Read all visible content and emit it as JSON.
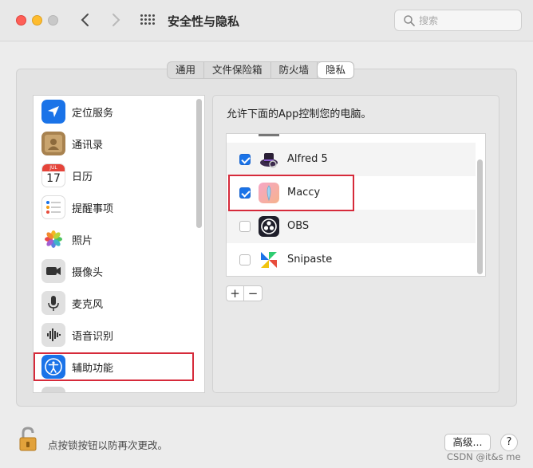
{
  "window": {
    "title": "安全性与隐私"
  },
  "search": {
    "placeholder": "搜索"
  },
  "tabs": [
    {
      "label": "通用",
      "active": false
    },
    {
      "label": "文件保险箱",
      "active": false
    },
    {
      "label": "防火墙",
      "active": false
    },
    {
      "label": "隐私",
      "active": true
    }
  ],
  "sidebar": {
    "items": [
      {
        "label": "定位服务",
        "icon": "location-arrow-icon"
      },
      {
        "label": "通讯录",
        "icon": "contacts-icon"
      },
      {
        "label": "日历",
        "icon": "calendar-icon",
        "icon_month": "JUL",
        "icon_day": "17"
      },
      {
        "label": "提醒事项",
        "icon": "reminders-icon"
      },
      {
        "label": "照片",
        "icon": "photos-icon"
      },
      {
        "label": "摄像头",
        "icon": "camera-icon"
      },
      {
        "label": "麦克风",
        "icon": "microphone-icon"
      },
      {
        "label": "语音识别",
        "icon": "speech-recognition-icon"
      },
      {
        "label": "辅助功能",
        "icon": "accessibility-icon",
        "selected": true
      }
    ]
  },
  "main": {
    "description": "允许下面的App控制您的电脑。",
    "apps": [
      {
        "name": "Alfred 5",
        "checked": true,
        "icon": "alfred-icon"
      },
      {
        "name": "Maccy",
        "checked": true,
        "icon": "maccy-icon"
      },
      {
        "name": "OBS",
        "checked": false,
        "icon": "obs-icon"
      },
      {
        "name": "Snipaste",
        "checked": false,
        "icon": "snipaste-icon"
      }
    ],
    "add_label": "+",
    "remove_label": "−"
  },
  "footer": {
    "lock_text": "点按锁按钮以防再次更改。",
    "advanced_label": "高级...",
    "help_label": "?"
  },
  "watermark": "CSDN @it&s me",
  "colors": {
    "accent_blue": "#1a73e8",
    "highlight_red": "#d62a3a"
  }
}
